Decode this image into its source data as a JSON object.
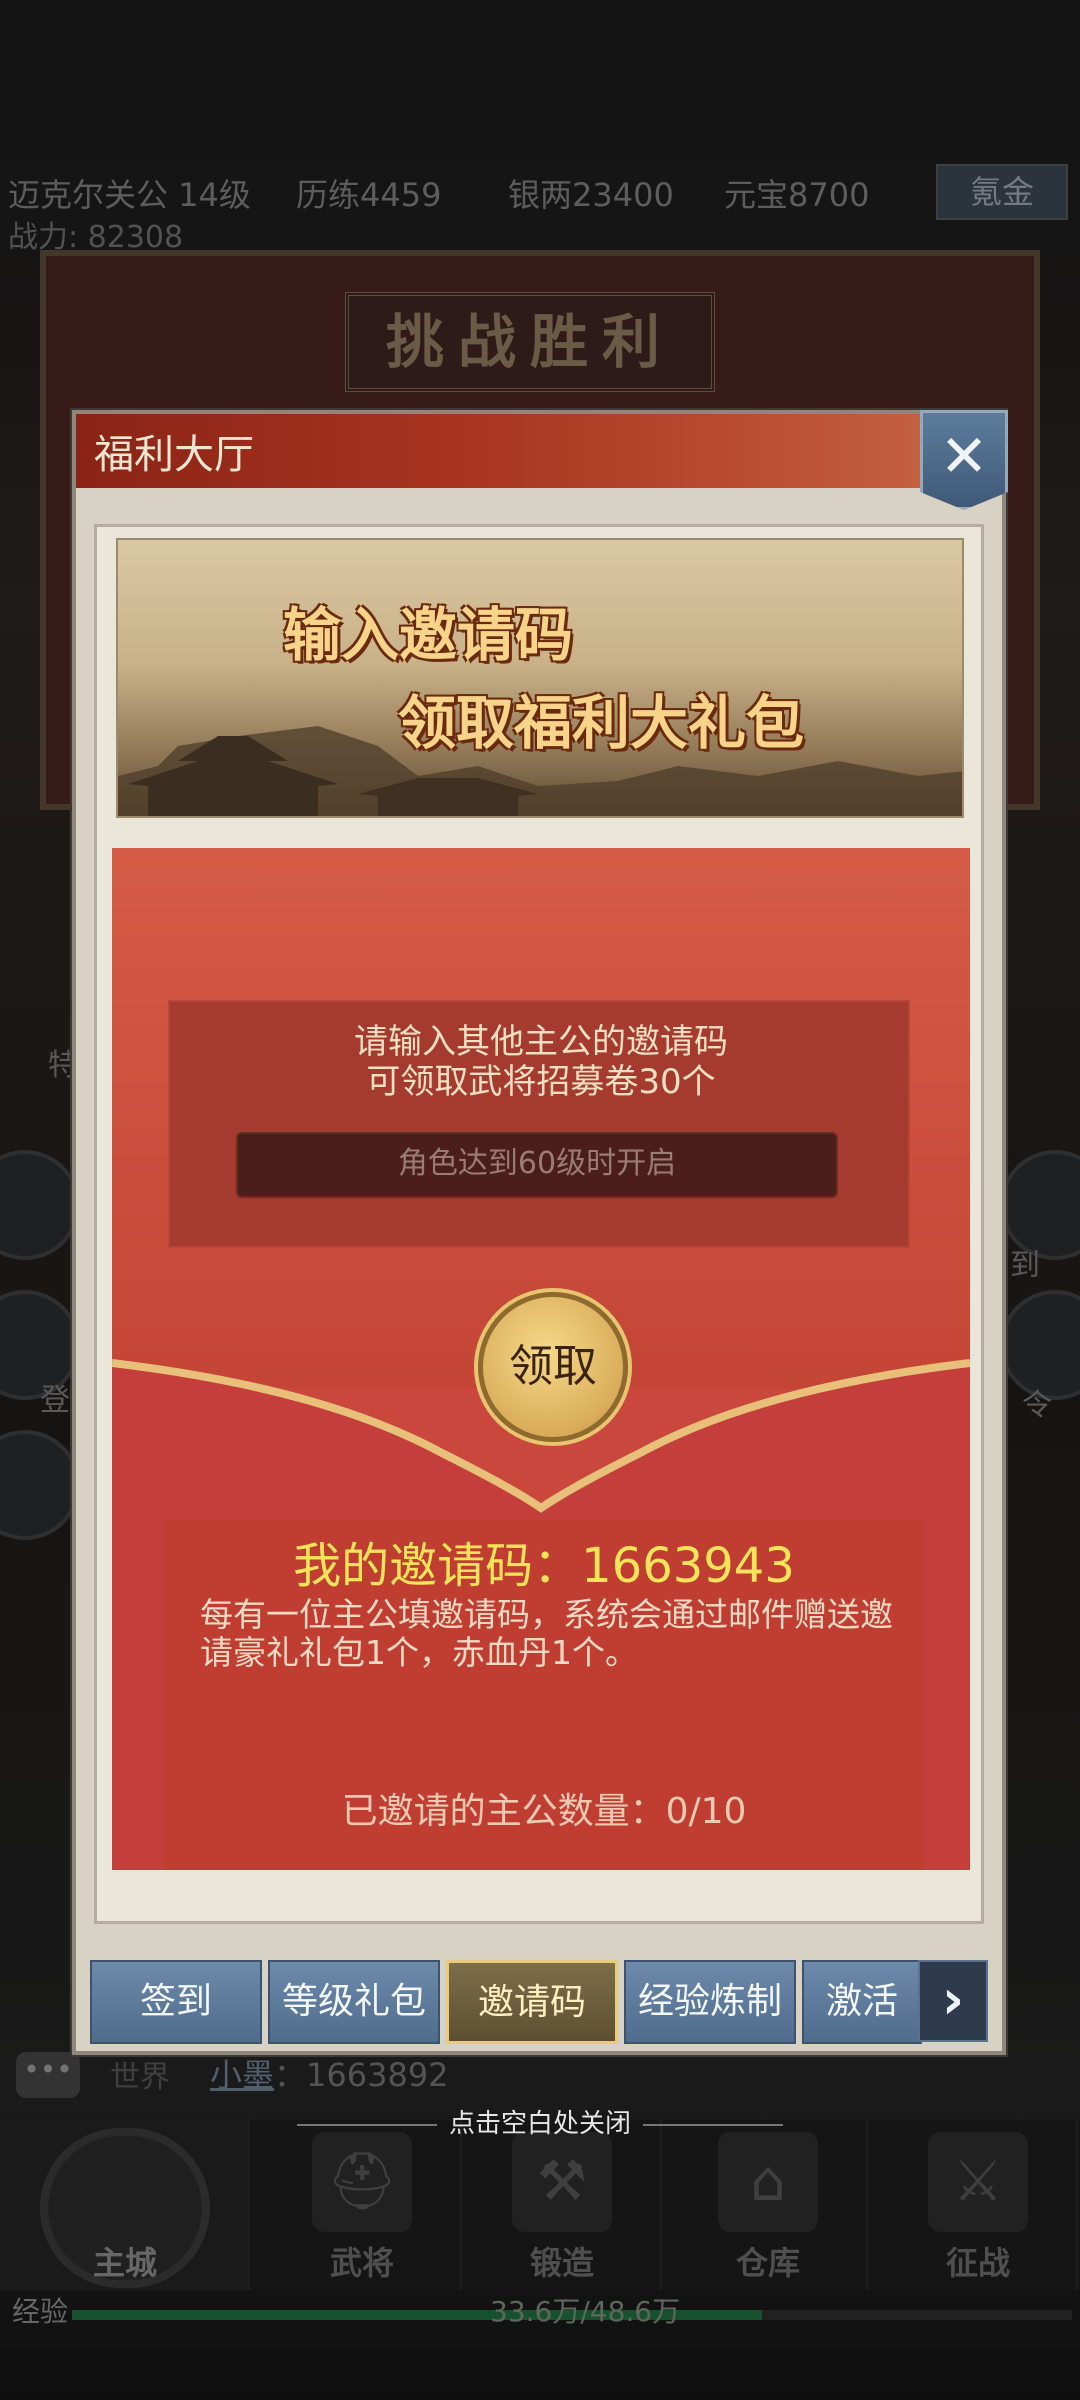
{
  "hud": {
    "player": "迈克尔关公 14级",
    "experience_stat": "历练4459",
    "silver": "银两23400",
    "ingots": "元宝8700",
    "recharge": "氪金",
    "power": "战力: 82308"
  },
  "victory_panel": {
    "title": "挑战胜利"
  },
  "modal": {
    "title": "福利大厅",
    "close_icon": "close-icon",
    "banner": {
      "line1": "输入邀请码",
      "line2": "领取福利大礼包"
    },
    "invite_input": {
      "hint_line1": "请输入其他主公的邀请码",
      "hint_line2": "可领取武将招募卷30个",
      "placeholder": "角色达到60级时开启"
    },
    "claim_button": "领取",
    "my_code": "我的邀请码：1663943",
    "description": "每有一位主公填邀请码，系统会通过邮件赠送邀请豪礼礼包1个，赤血丹1个。",
    "invited_count": "已邀请的主公数量：0/10",
    "tabs": [
      {
        "label": "签到",
        "active": false
      },
      {
        "label": "等级礼包",
        "active": false
      },
      {
        "label": "邀请码",
        "active": true
      },
      {
        "label": "经验炼制",
        "active": false
      },
      {
        "label": "激活",
        "active": false
      }
    ],
    "tabs_next_icon": "chevron-right-icon"
  },
  "chat": {
    "bubble": "•••",
    "channel": "世界",
    "sender": "小墨",
    "message": "：1663892"
  },
  "tap_to_close": "点击空白处关闭",
  "bottom_nav": [
    {
      "label": "主城",
      "icon": "city-gate-icon"
    },
    {
      "label": "武将",
      "icon": "helmet-icon"
    },
    {
      "label": "锻造",
      "icon": "anvil-icon"
    },
    {
      "label": "仓库",
      "icon": "warehouse-icon"
    },
    {
      "label": "征战",
      "icon": "sword-icon"
    }
  ],
  "exp": {
    "label": "经验",
    "value": "33.6万/48.6万",
    "progress": 0.69
  },
  "side_labels": {
    "left_top": "特",
    "right_top": "到",
    "left_mid": "登",
    "right_mid": "令"
  },
  "colors": {
    "accent_red": "#c9473c",
    "gold": "#f9e35a",
    "tab_blue": "#5d7c9b"
  }
}
